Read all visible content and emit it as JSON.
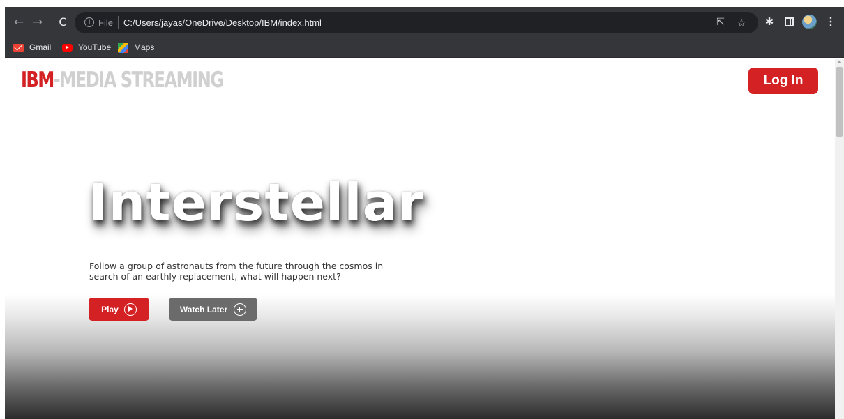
{
  "browser": {
    "nav": {
      "back": "←",
      "forward": "→",
      "reload": "C"
    },
    "omnibox": {
      "scheme": "File",
      "url": "C:/Users/jayas/OneDrive/Desktop/IBM/index.html"
    },
    "bookmarks": [
      {
        "label": "Gmail",
        "icon": "gmail-icon"
      },
      {
        "label": "YouTube",
        "icon": "youtube-icon"
      },
      {
        "label": "Maps",
        "icon": "maps-icon"
      }
    ]
  },
  "page": {
    "logo": {
      "brand": "IBM",
      "rest": "-MEDIA STREAMING"
    },
    "login_label": "Log In",
    "hero": {
      "title": "Interstellar",
      "description": "Follow a group of astronauts from the future through the cosmos in search of an earthly replacement, what will happen next?",
      "play_label": "Play",
      "watch_later_label": "Watch Later"
    }
  },
  "colors": {
    "accent": "#d32124",
    "secondary_button": "#6b6b6b",
    "browser_chrome": "#35363a",
    "omnibox": "#202124"
  }
}
